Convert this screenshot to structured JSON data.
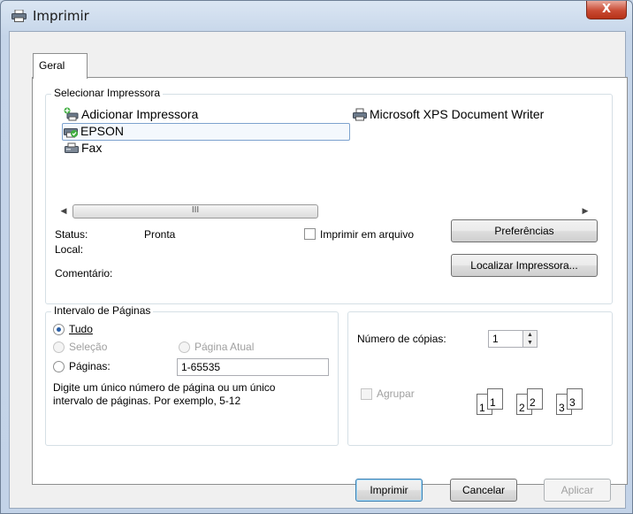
{
  "window": {
    "title": "Imprimir",
    "close_glyph": "X"
  },
  "tabs": [
    {
      "label": "Geral"
    }
  ],
  "select_printer": {
    "legend": "Selecionar Impressora",
    "printers": [
      {
        "name": "Adicionar Impressora",
        "icon": "add-printer-icon"
      },
      {
        "name": "Microsoft XPS Document Writer",
        "icon": "printer-icon"
      },
      {
        "name": "EPSON",
        "icon": "printer-default-icon",
        "selected": true
      },
      {
        "name": "Fax",
        "icon": "fax-icon"
      }
    ],
    "scroll_grip": "III",
    "status_label": "Status:",
    "status_value": "Pronta",
    "location_label": "Local:",
    "comment_label": "Comentário:",
    "print_to_file_label": "Imprimir em arquivo",
    "print_to_file_checked": false,
    "preferences_button": "Preferências",
    "find_printer_button": "Localizar Impressora..."
  },
  "page_range": {
    "legend": "Intervalo de Páginas",
    "all_label": "Tudo",
    "selection_label": "Seleção",
    "current_page_label": "Página Atual",
    "pages_label": "Páginas:",
    "pages_value": "1-65535",
    "hint": "Digite um único número de página ou um único intervalo de páginas. Por exemplo, 5-12",
    "selected_option": "all"
  },
  "copies": {
    "label": "Número de cópias:",
    "value": "1",
    "collate_label": "Agrupar",
    "collate_checked": false,
    "collate_pages": [
      "1",
      "1",
      "2",
      "2",
      "3",
      "3"
    ]
  },
  "footer": {
    "print_button": "Imprimir",
    "cancel_button": "Cancelar",
    "apply_button": "Aplicar"
  },
  "colors": {
    "title_gradient": "#c5d5e9",
    "close_button": "#c94b34",
    "selection_border": "#7da2ce",
    "radio_dot": "#2a5fa6"
  }
}
